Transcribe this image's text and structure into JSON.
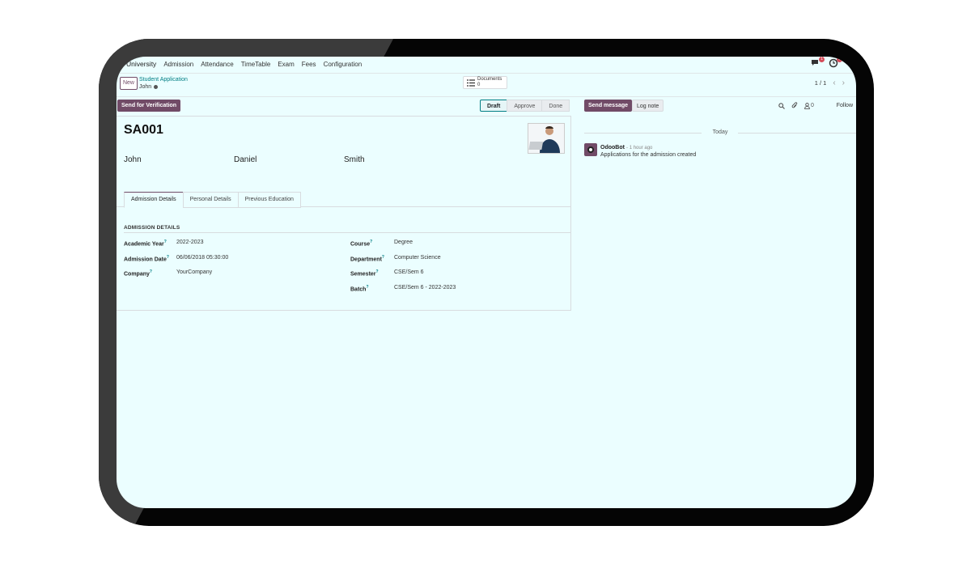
{
  "nav": {
    "app_name": "University",
    "menu": [
      "Admission",
      "Attendance",
      "TimeTable",
      "Exam",
      "Fees",
      "Configuration"
    ],
    "messages_badge": "1",
    "activities_badge": "1"
  },
  "control_panel": {
    "new_label": "New",
    "breadcrumb_parent": "Student Application",
    "breadcrumb_current": "John",
    "documents_label": "Documents",
    "documents_count": "0",
    "pager_value": "1 / 1"
  },
  "statusbar": {
    "primary_button": "Send for Verification",
    "stages": [
      "Draft",
      "Approve",
      "Done"
    ],
    "active_stage": "Draft"
  },
  "record": {
    "reference": "SA001",
    "first_name": "John",
    "middle_name": "Daniel",
    "last_name": "Smith"
  },
  "tabs": [
    "Admission Details",
    "Personal Details",
    "Previous Education"
  ],
  "admission_details": {
    "section_title": "ADMISSION DETAILS",
    "left_fields": [
      {
        "label": "Academic Year",
        "value": "2022-2023"
      },
      {
        "label": "Admission Date",
        "value": "06/06/2018 05:30:00"
      },
      {
        "label": "Company",
        "value": "YourCompany"
      }
    ],
    "right_fields": [
      {
        "label": "Course",
        "value": "Degree"
      },
      {
        "label": "Department",
        "value": "Computer Science"
      },
      {
        "label": "Semester",
        "value": "CSE/Sem 6"
      },
      {
        "label": "Batch",
        "value": "CSE/Sem 6 - 2022-2023"
      }
    ]
  },
  "chatter": {
    "send_message": "Send message",
    "log_note": "Log note",
    "followers_count": "0",
    "follow": "Follow",
    "date_separator": "Today",
    "messages": [
      {
        "author": "OdooBot",
        "time": "- 1 hour ago",
        "body": "Applications for the admission created"
      }
    ]
  },
  "colors": {
    "primary": "#714b67",
    "accent": "#017e84",
    "background": "#ebfeff"
  }
}
